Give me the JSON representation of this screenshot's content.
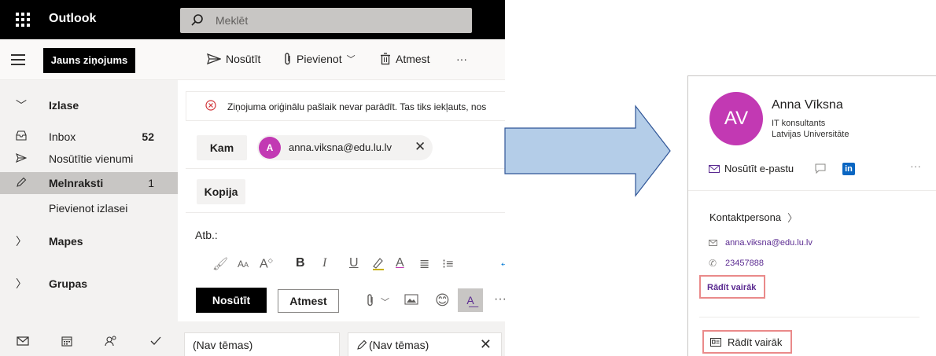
{
  "outlook": {
    "app_name": "Outlook",
    "search_placeholder": "Meklēt",
    "new_message": "Jauns ziņojums",
    "commands": {
      "send": "Nosūtīt",
      "attach": "Pievienot",
      "discard": "Atmest",
      "more": "···"
    },
    "nav": {
      "favorites": "Izlase",
      "inbox": "Inbox",
      "inbox_count": "52",
      "sent": "Nosūtītie vienumi",
      "drafts": "Melnraksti",
      "drafts_count": "1",
      "add_favorite": "Pievienot izlasei",
      "folders": "Mapes",
      "groups": "Grupas"
    },
    "compose": {
      "error_text": "Ziņojuma oriģinālu pašlaik nevar parādīt. Tas tiks iekļauts, nos",
      "to_label": "Kam",
      "recipient_initial": "A",
      "recipient_email": "anna.viksna@edu.lu.lv",
      "cc_label": "Kopija",
      "subject_label": "Atb.:",
      "send_button": "Nosūtīt",
      "discard_button": "Atmest"
    },
    "draft_tabs": [
      {
        "title": "(Nav tēmas)"
      },
      {
        "title": "(Nav tēmas)"
      }
    ]
  },
  "contact_card": {
    "initials": "AV",
    "name": "Anna Vīksna",
    "job_title": "IT konsultants",
    "organization": "Latvijas Universitāte",
    "send_email": "Nosūtīt e-pastu",
    "linkedin": "in",
    "more": "···",
    "section_title": "Kontaktpersona",
    "email": "anna.viksna@edu.lu.lv",
    "phone": "23457888",
    "show_more_link": "Rādīt vairāk",
    "show_more_button": "Rādīt vairāk"
  },
  "colors": {
    "avatar": "#c239b3",
    "link": "#5b2b91",
    "highlight_box": "#ea8a8a",
    "arrow_fill": "#b4cde8",
    "arrow_stroke": "#2f5597"
  }
}
